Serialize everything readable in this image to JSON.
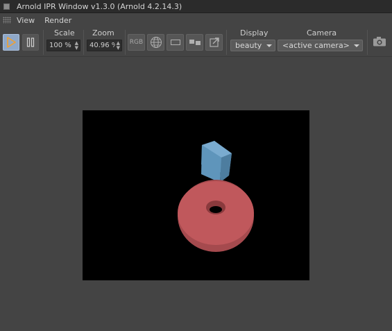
{
  "window": {
    "title": "Arnold IPR Window v1.3.0 (Arnold 4.2.14.3)"
  },
  "menu": {
    "items": [
      "View",
      "Render"
    ]
  },
  "toolbar": {
    "scale": {
      "label": "Scale",
      "value": "100 %"
    },
    "zoom": {
      "label": "Zoom",
      "value": "40.96 %"
    },
    "rgb_label": "RGB",
    "display": {
      "label": "Display",
      "value": "beauty"
    },
    "camera": {
      "label": "Camera",
      "value": "<active camera>"
    }
  },
  "icons": {
    "play": "play-icon",
    "pause": "pause-icon",
    "globe": "globe-icon",
    "region": "region-icon",
    "compare": "compare-icon",
    "export": "export-icon",
    "snapshot": "camera-icon"
  },
  "colors": {
    "accent": "#8fa8c8",
    "play_glyph": "#f0a030",
    "cube": "#5b8fb3",
    "torus": "#c0565a",
    "background": "#444444"
  }
}
